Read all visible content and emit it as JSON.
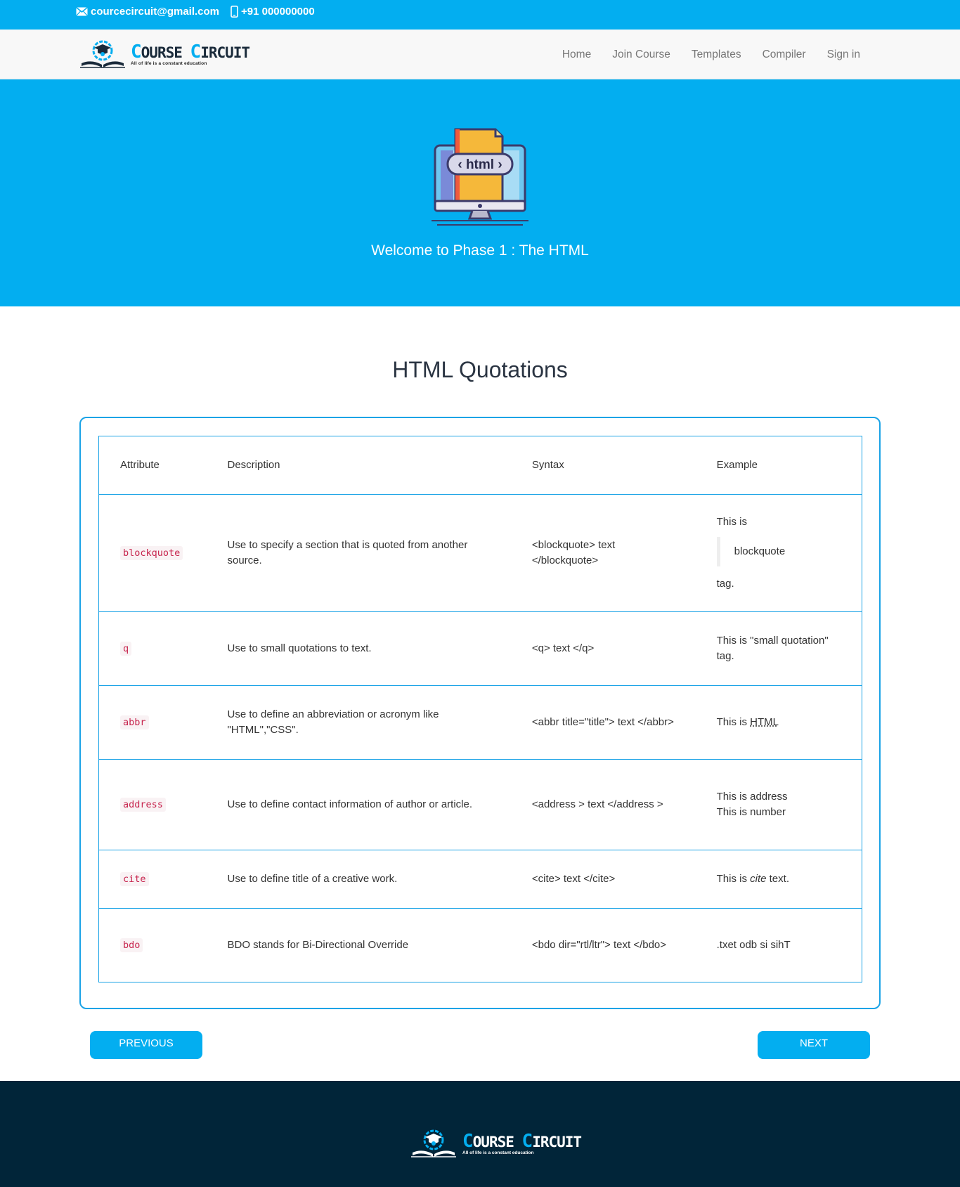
{
  "topbar": {
    "email": "courcecircuit@gmail.com",
    "phone": "+91 000000000",
    "email_icon": "envelope-icon",
    "phone_icon": "mobile-phone-icon"
  },
  "brand": {
    "name_first_letter": "C",
    "name_first_rest": "OURSE",
    "name_second_letter": "C",
    "name_second_rest": "IRCUIT",
    "tagline": "All of life is a constant education"
  },
  "nav": {
    "items": [
      {
        "label": "Home"
      },
      {
        "label": "Join Course"
      },
      {
        "label": "Templates"
      },
      {
        "label": "Compiler"
      },
      {
        "label": "Sign in"
      }
    ]
  },
  "hero": {
    "art_label": "html",
    "title": "Welcome to Phase 1 : The HTML"
  },
  "section": {
    "title": "HTML Quotations"
  },
  "table": {
    "headers": [
      "Attribute",
      "Description",
      "Syntax",
      "Example"
    ],
    "rows": [
      {
        "attribute": "blockquote",
        "description": "Use to specify a section that is quoted from another source.",
        "syntax": "<blockquote> text </blockquote>",
        "example_before": "This is",
        "example_quote": "blockquote",
        "example_after": "tag."
      },
      {
        "attribute": "q",
        "description": "Use to small quotations to text.",
        "syntax": "<q> text </q>",
        "example": "This is \"small quotation\" tag."
      },
      {
        "attribute": "abbr",
        "description": "Use to define an abbreviation or acronym like \"HTML\",\"CSS\".",
        "syntax": "<abbr title=\"title\"> text </abbr>",
        "example_prefix": "This is ",
        "example_abbr": "HTML"
      },
      {
        "attribute": "address",
        "description": "Use to define contact information of author or article.",
        "syntax": "<address > text </address >",
        "example_line1": "This is address",
        "example_line2": "This is number"
      },
      {
        "attribute": "cite",
        "description": "Use to define title of a creative work.",
        "syntax": "<cite> text </cite>",
        "example_prefix": "This is ",
        "example_cite": "cite",
        "example_suffix": " text."
      },
      {
        "attribute": "bdo",
        "description": "BDO stands for Bi-Directional Override",
        "syntax": "<bdo dir=\"rtl/ltr\"> text </bdo>",
        "example": ".txet odb si sihT"
      }
    ]
  },
  "buttons": {
    "previous": "PREVIOUS",
    "next": "NEXT"
  },
  "colors": {
    "accent": "#03aef0",
    "footer": "#012539",
    "code": "#c7254e"
  }
}
